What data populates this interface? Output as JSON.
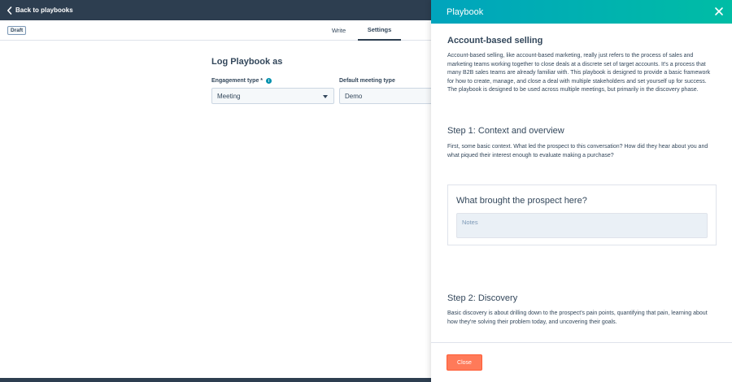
{
  "topbar": {
    "back_label": "Back to playbooks"
  },
  "subbar": {
    "status_badge": "Draft",
    "tabs": [
      {
        "label": "Write",
        "active": false
      },
      {
        "label": "Settings",
        "active": true
      }
    ]
  },
  "settings": {
    "title": "Log Playbook as",
    "engagement_type": {
      "label": "Engagement type *",
      "value": "Meeting"
    },
    "default_meeting_type": {
      "label": "Default meeting type",
      "value": "Demo"
    }
  },
  "panel": {
    "title": "Playbook",
    "intro_heading": "Account-based selling",
    "intro_text": "Account-based selling, like account-based marketing, really just refers to the process of sales and marketing teams working together to close deals at a discrete set of target accounts. It's a process that many B2B sales teams are already familiar with. This playbook is designed to provide a basic framework for how to create, manage, and close a deal with multiple stakeholders and set yourself up for success. The playbook is designed to be used across multiple meetings, but primarily in the discovery phase.",
    "step1_heading": "Step 1: Context and overview",
    "step1_text": "First, some basic context. What led the prospect to this conversation? How did they hear about you and what piqued their interest enough to evaluate making a purchase?",
    "question_card": {
      "title": "What brought the prospect here?",
      "notes_placeholder": "Notes"
    },
    "step2_heading": "Step 2: Discovery",
    "step2_text": "Basic discovery is about drilling down to the prospect's pain points, quantifying that pain, learning about how they're solving their problem today, and uncovering their goals.",
    "close_label": "Close"
  },
  "colors": {
    "topbar": "#2d3e50",
    "panel_header_start": "#00a4bd",
    "panel_header_end": "#00bda5",
    "close_button": "#ff7a59",
    "text": "#33475b"
  }
}
